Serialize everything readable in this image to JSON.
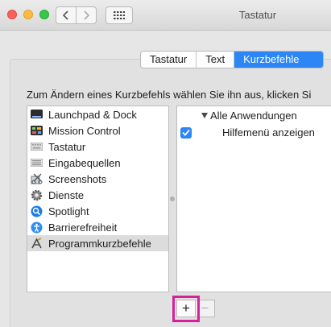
{
  "window": {
    "title": "Tastatur"
  },
  "tabs": [
    {
      "label": "Tastatur",
      "active": false
    },
    {
      "label": "Text",
      "active": false
    },
    {
      "label": "Kurzbefehle",
      "active": true
    }
  ],
  "instruction": "Zum Ändern eines Kurzbefehls wählen Sie ihn aus, klicken Si",
  "categories": [
    {
      "label": "Launchpad & Dock",
      "icon": "launchpad-dock-icon"
    },
    {
      "label": "Mission Control",
      "icon": "mission-control-icon"
    },
    {
      "label": "Tastatur",
      "icon": "keyboard-icon"
    },
    {
      "label": "Eingabequellen",
      "icon": "input-sources-icon"
    },
    {
      "label": "Screenshots",
      "icon": "screenshots-icon"
    },
    {
      "label": "Dienste",
      "icon": "gear-icon"
    },
    {
      "label": "Spotlight",
      "icon": "spotlight-icon"
    },
    {
      "label": "Barrierefreiheit",
      "icon": "accessibility-icon"
    },
    {
      "label": "Programmkurzbefehle",
      "icon": "app-shortcuts-icon",
      "selected": true
    }
  ],
  "shortcuts": {
    "group_label": "Alle Anwendungen",
    "items": [
      {
        "label": "Hilfemenü anzeigen",
        "checked": true
      }
    ]
  },
  "buttons": {
    "add": "+",
    "remove": "−"
  },
  "colors": {
    "accent": "#2c86f6",
    "highlight": "#d6219b"
  }
}
